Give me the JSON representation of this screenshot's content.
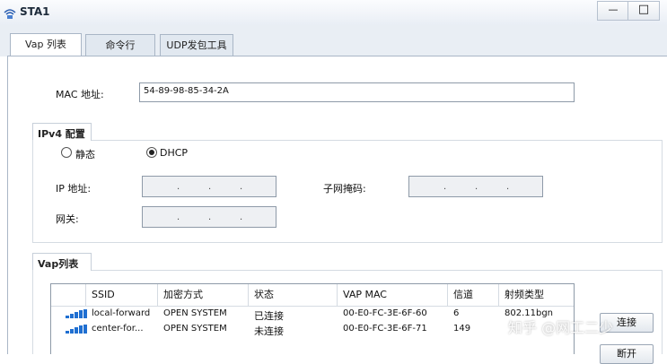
{
  "window": {
    "title": "STA1",
    "minimize": "—",
    "maximize": "□"
  },
  "tabs": [
    {
      "label": "Vap 列表",
      "active": true
    },
    {
      "label": "命令行",
      "active": false
    },
    {
      "label": "UDP发包工具",
      "active": false
    }
  ],
  "mac": {
    "label": "MAC 地址:",
    "value": "54-89-98-85-34-2A"
  },
  "ipv4": {
    "title": "IPv4 配置",
    "static_label": "静态",
    "dhcp_label": "DHCP",
    "selected": "DHCP",
    "ip_label": "IP 地址:",
    "mask_label": "子网掩码:",
    "gateway_label": "网关:",
    "ip_dot": "."
  },
  "vap": {
    "title": "Vap列表",
    "columns": [
      "SSID",
      "加密方式",
      "状态",
      "VAP MAC",
      "信道",
      "射频类型"
    ],
    "rows": [
      {
        "ssid": "local-forward",
        "encryption": "OPEN SYSTEM",
        "status": "已连接",
        "vap_mac": "00-E0-FC-3E-6F-60",
        "channel": "6",
        "radio": "802.11bgn"
      },
      {
        "ssid": "center-for...",
        "encryption": "OPEN SYSTEM",
        "status": "未连接",
        "vap_mac": "00-E0-FC-3E-6F-71",
        "channel": "149",
        "radio": ""
      }
    ],
    "connect_button": "连接",
    "disconnect_button": "断开"
  },
  "watermark": "知乎 @网工二少",
  "colors": {
    "signal": "#1f6fd1",
    "titlebar": "#e9eef5"
  }
}
